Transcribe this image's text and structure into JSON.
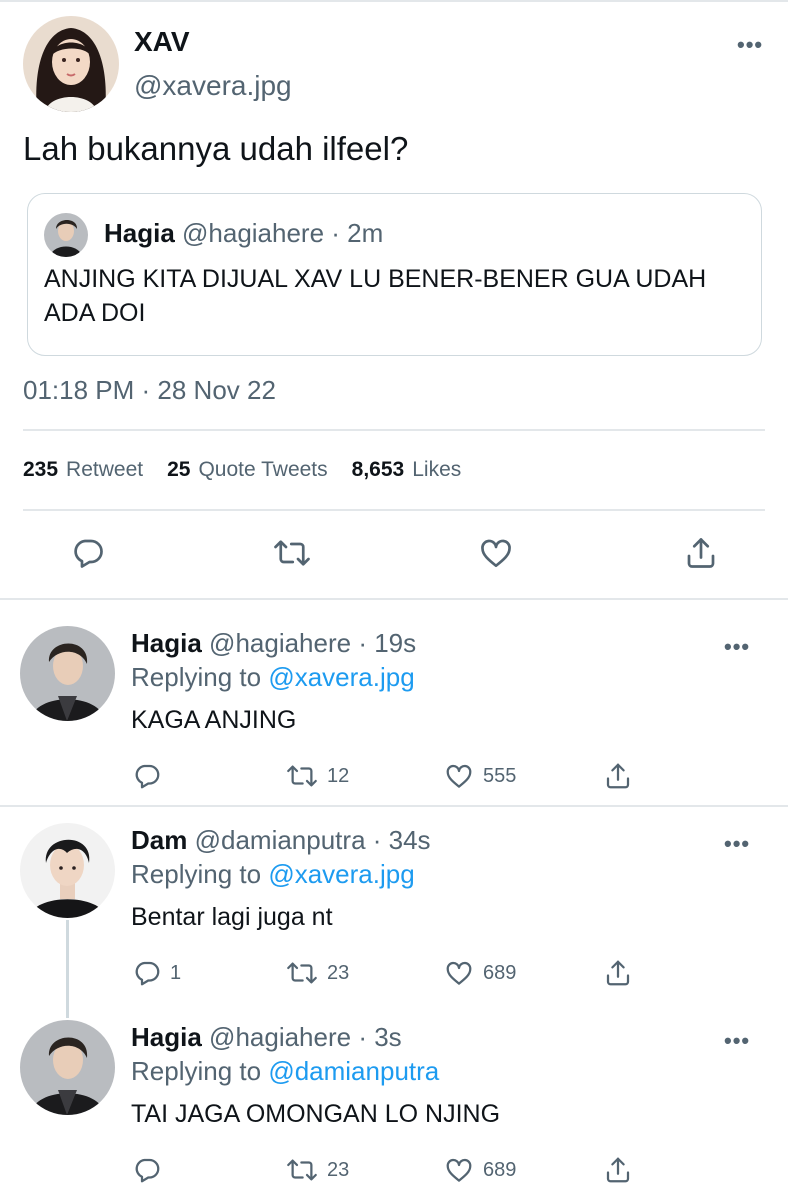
{
  "main_tweet": {
    "author_name": "XAV",
    "author_handle": "@xavera.jpg",
    "text": "Lah bukannya udah ilfeel?",
    "more": "•••",
    "quoted": {
      "author_name": "Hagia",
      "meta": "@hagiahere · 2m",
      "text": "ANJING KITA DIJUAL XAV LU BENER-BENER GUA UDAH ADA DOI"
    },
    "timestamp": "01:18 PM · 28 Nov 22",
    "stats": [
      {
        "num": "235",
        "label": "Retweet"
      },
      {
        "num": "25",
        "label": "Quote Tweets"
      },
      {
        "num": "8,653",
        "label": "Likes"
      }
    ]
  },
  "replies": [
    {
      "name": "Hagia",
      "meta": "@hagiahere · 19s",
      "replying_prefix": "Replying to",
      "replying_to": "@xavera.jpg",
      "text": "KAGA ANJING",
      "reply_count": "",
      "retweet_count": "12",
      "like_count": "555"
    },
    {
      "name": "Dam",
      "meta": "@damianputra · 34s",
      "replying_prefix": "Replying to",
      "replying_to": "@xavera.jpg",
      "text": "Bentar lagi juga nt",
      "reply_count": "1",
      "retweet_count": "23",
      "like_count": "689"
    },
    {
      "name": "Hagia",
      "meta": "@hagiahere · 3s",
      "replying_prefix": "Replying to",
      "replying_to": "@damianputra",
      "text": "TAI JAGA OMONGAN LO NJING",
      "reply_count": "",
      "retweet_count": "23",
      "like_count": "689"
    }
  ],
  "icons": [
    "reply-icon",
    "retweet-icon",
    "like-icon",
    "share-icon",
    "more-icon"
  ],
  "colors": {
    "text": "#0f1419",
    "secondary": "#536471",
    "link": "#1d9bf0",
    "border": "#cfd9de"
  }
}
